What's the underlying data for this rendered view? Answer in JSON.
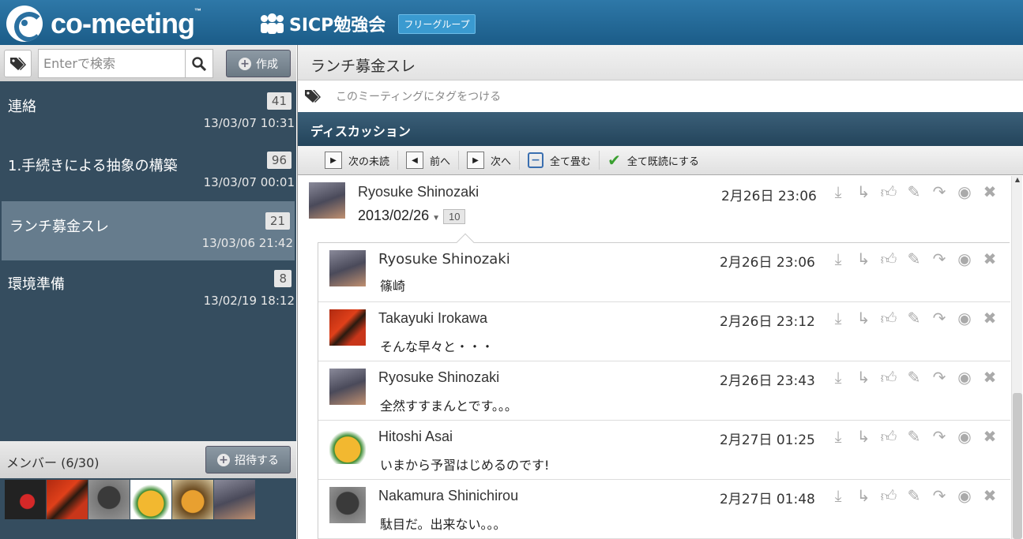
{
  "app": {
    "name": "co-meeting",
    "tm": "™"
  },
  "group": {
    "title": "SICP勉強会",
    "badge": "フリーグループ"
  },
  "sidebar": {
    "search_placeholder": "Enterで検索",
    "create_label": "作成",
    "meetings": [
      {
        "name": "連絡",
        "count": "41",
        "date": "13/03/07 10:31"
      },
      {
        "name": "1.手続きによる抽象の構築",
        "count": "96",
        "date": "13/03/07 00:01"
      },
      {
        "name": "ランチ募金スレ",
        "count": "21",
        "date": "13/03/06 21:42"
      },
      {
        "name": "環境準備",
        "count": "8",
        "date": "13/02/19 18:12"
      }
    ],
    "members_label": "メンバー (6/30)",
    "invite_label": "招待する"
  },
  "main": {
    "title": "ランチ募金スレ",
    "tag_placeholder": "このミーティングにタグをつける",
    "discussion_label": "ディスカッション",
    "toolbar": {
      "next_unread": "次の未読",
      "prev": "前へ",
      "next": "次へ",
      "collapse_all": "全て畳む",
      "mark_all_read": "全て既読にする"
    },
    "top_post": {
      "author": "Ryosuke Shinozaki",
      "time": "2月26日 23:06",
      "subject": "2013/02/26",
      "reply_count": "10"
    },
    "replies": [
      {
        "author": "Ryosuke Shinozaki",
        "time": "2月26日 23:06",
        "body": "篠崎"
      },
      {
        "author": "Takayuki Irokawa",
        "time": "2月26日 23:12",
        "body": "そんな早々と・・・"
      },
      {
        "author": "Ryosuke Shinozaki",
        "time": "2月26日 23:43",
        "body": "全然すすまんとです。。。"
      },
      {
        "author": "Hitoshi Asai",
        "time": "2月27日 01:25",
        "body": "いまから予習はじめるのです!"
      },
      {
        "author": "Nakamura Shinichirou",
        "time": "2月27日 01:48",
        "body": "駄目だ。出来ない。。。"
      }
    ]
  },
  "icons": {
    "download": "download-icon",
    "reply": "reply-icon",
    "like": "thumbs-up-icon",
    "edit": "edit-icon",
    "share": "share-icon",
    "globe": "globe-icon",
    "delete": "delete-icon"
  }
}
